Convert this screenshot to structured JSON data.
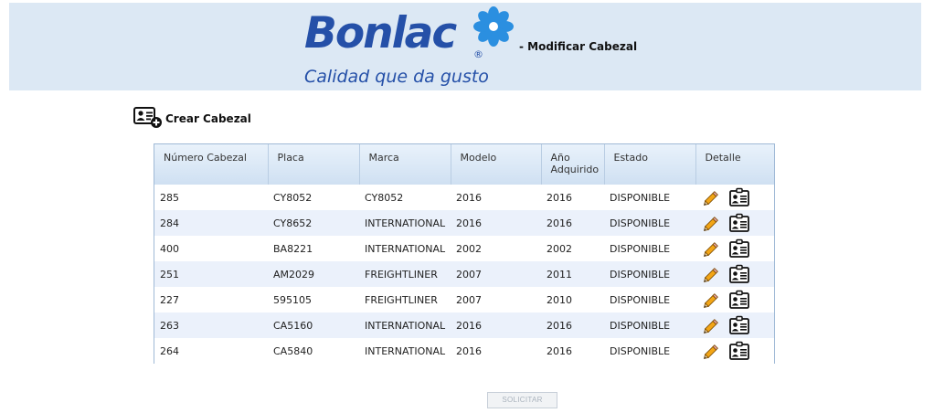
{
  "header": {
    "logo_text": "Bonlac",
    "logo_registered": "®",
    "tagline": "Calidad que da gusto",
    "title": "- Modificar Cabezal",
    "background": "#dce8f4",
    "brand_color": "#2550a8",
    "flower_color": "#2b8fe0"
  },
  "create": {
    "label": "Crear Cabezal",
    "icon": "add-contact-card-icon"
  },
  "table": {
    "columns": [
      "Número Cabezal",
      "Placa",
      "Marca",
      "Modelo",
      "Año Adquirido",
      "Estado",
      "Detalle"
    ],
    "rows": [
      {
        "numero": "285",
        "placa": "CY8052",
        "marca": "CY8052",
        "modelo": "2016",
        "anio": "2016",
        "estado": "DISPONIBLE"
      },
      {
        "numero": "284",
        "placa": "CY8652",
        "marca": "INTERNATIONAL",
        "modelo": "2016",
        "anio": "2016",
        "estado": "DISPONIBLE"
      },
      {
        "numero": "400",
        "placa": "BA8221",
        "marca": "INTERNATIONAL",
        "modelo": "2002",
        "anio": "2002",
        "estado": "DISPONIBLE"
      },
      {
        "numero": "251",
        "placa": "AM2029",
        "marca": "FREIGHTLINER",
        "modelo": "2007",
        "anio": "2011",
        "estado": "DISPONIBLE"
      },
      {
        "numero": "227",
        "placa": "595105",
        "marca": "FREIGHTLINER",
        "modelo": "2007",
        "anio": "2010",
        "estado": "DISPONIBLE"
      },
      {
        "numero": "263",
        "placa": "CA5160",
        "marca": "INTERNATIONAL",
        "modelo": "2016",
        "anio": "2016",
        "estado": "DISPONIBLE"
      },
      {
        "numero": "264",
        "placa": "CA5840",
        "marca": "INTERNATIONAL",
        "modelo": "2016",
        "anio": "2016",
        "estado": "DISPONIBLE"
      }
    ],
    "row_icons": [
      "edit-pencil-icon",
      "detail-contact-card-icon"
    ],
    "alt_row_color": "#ebf1fb"
  },
  "submit": {
    "label": "SOLICITAR",
    "disabled": true
  }
}
